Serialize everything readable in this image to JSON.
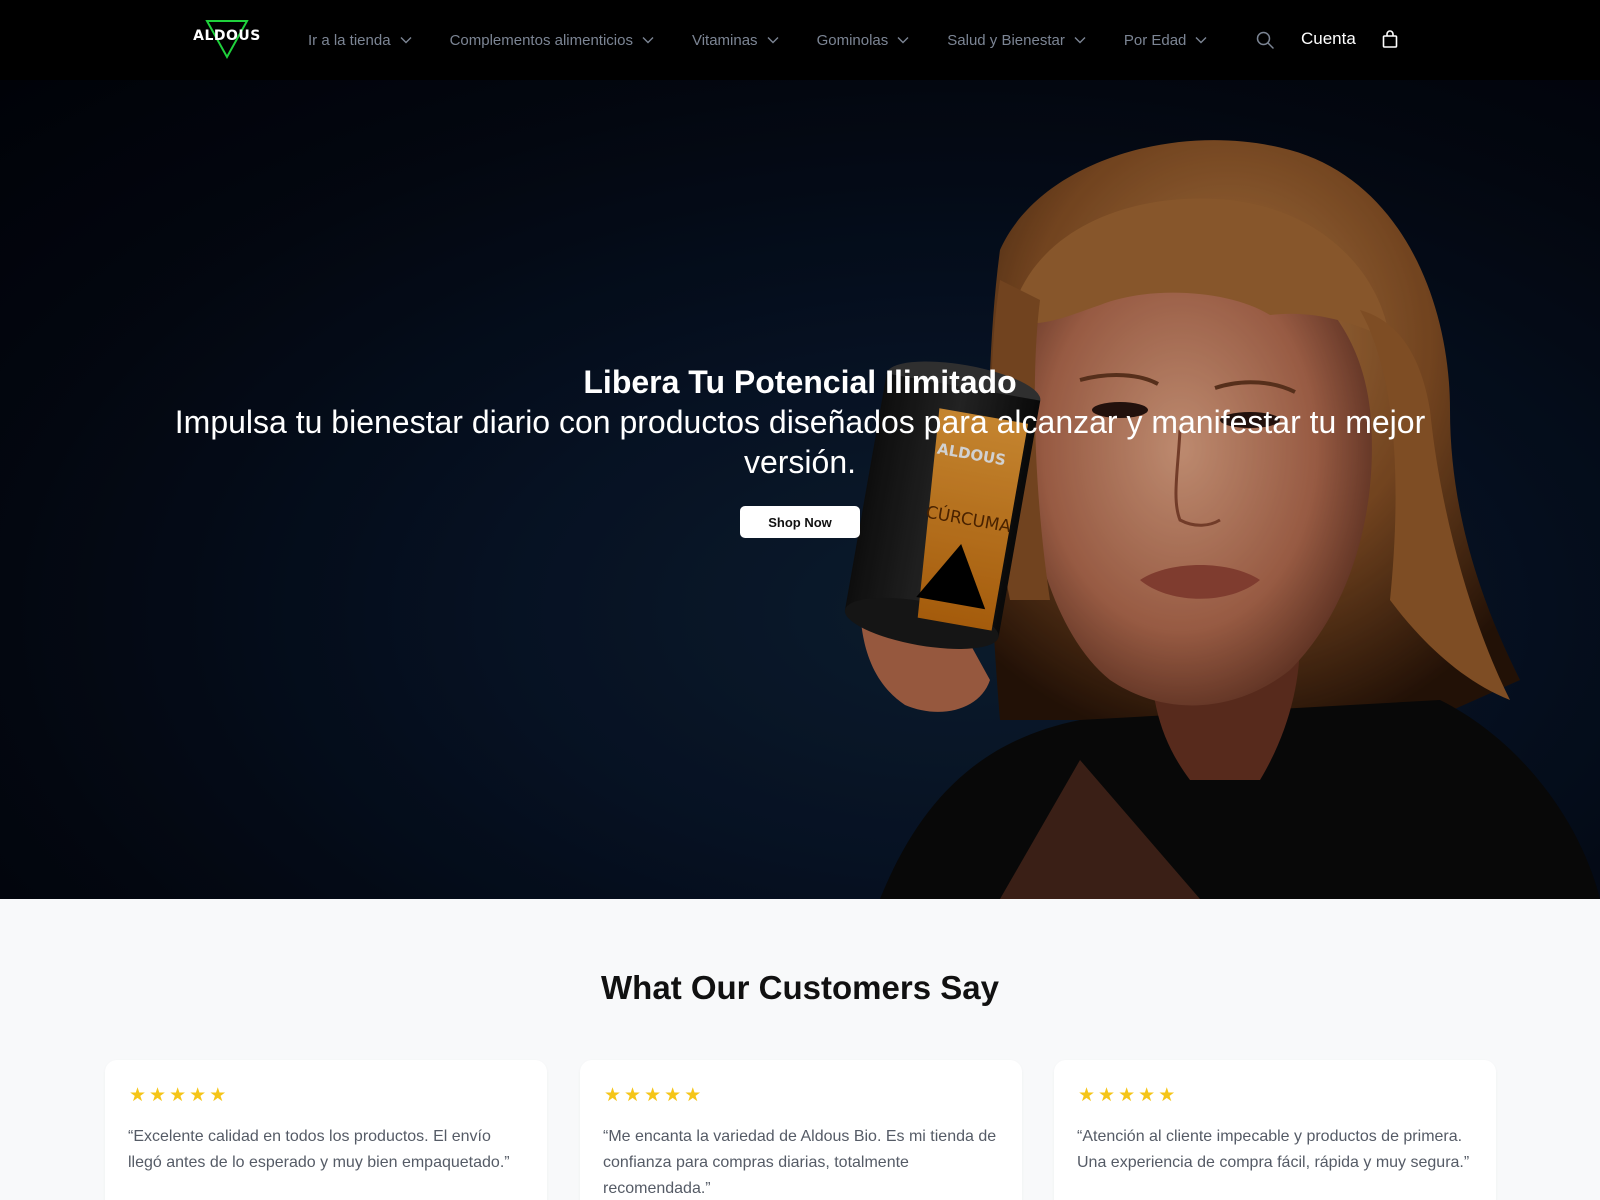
{
  "header": {
    "logo_text": "ALDOUS",
    "nav": [
      {
        "label": "Ir a la tienda"
      },
      {
        "label": "Complementos alimenticios"
      },
      {
        "label": "Vitaminas"
      },
      {
        "label": "Gominolas"
      },
      {
        "label": "Salud y Bienestar"
      },
      {
        "label": "Por Edad"
      }
    ],
    "account_label": "Cuenta",
    "icons": {
      "search": "search-icon",
      "cart": "shopping-bag-icon",
      "dropdown": "chevron-down-icon"
    },
    "brand_accent": "#1fd13c"
  },
  "hero": {
    "title": "Libera Tu Potencial Ilimitado",
    "subtitle": "Impulsa tu bienestar diario con productos diseñados para alcanzar y manifestar tu mejor versión.",
    "cta_label": "Shop Now",
    "product": {
      "brand": "ALDOUS",
      "name": "CÚRCUMA"
    }
  },
  "testimonials": {
    "title": "What Our Customers Say",
    "star_color": "#f5c518",
    "cards": [
      {
        "rating": 5,
        "quote": "“Excelente calidad en todos los productos. El envío llegó antes de lo esperado y muy bien empaquetado.”"
      },
      {
        "rating": 5,
        "quote": "“Me encanta la variedad de Aldous Bio. Es mi tienda de confianza para compras diarias, totalmente recomendada.”"
      },
      {
        "rating": 5,
        "quote": "“Atención al cliente impecable y productos de primera. Una experiencia de compra fácil, rápida y muy segura.”"
      }
    ]
  }
}
